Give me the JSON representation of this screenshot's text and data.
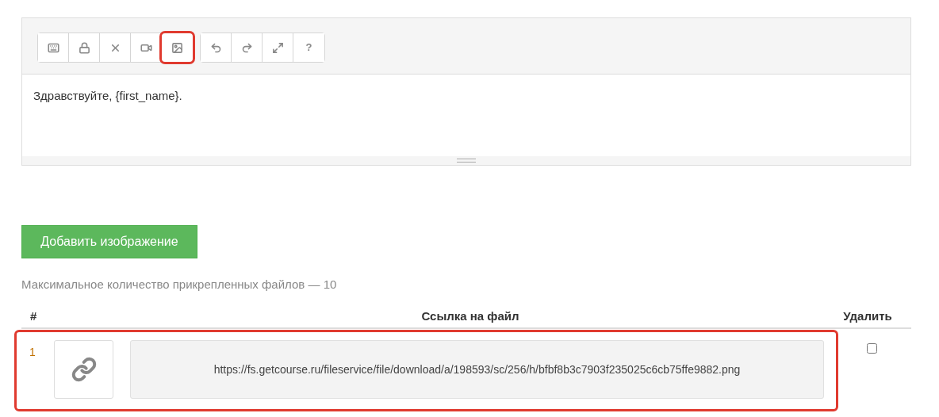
{
  "editor": {
    "toolbar_groups": [
      [
        {
          "kind": "keyboard",
          "highlighted": false
        },
        {
          "kind": "lock",
          "highlighted": false
        },
        {
          "kind": "remove",
          "highlighted": false
        },
        {
          "kind": "video",
          "highlighted": false
        },
        {
          "kind": "image",
          "highlighted": true
        }
      ],
      [
        {
          "kind": "undo",
          "highlighted": false
        },
        {
          "kind": "redo",
          "highlighted": false
        },
        {
          "kind": "fullscreen",
          "highlighted": false
        },
        {
          "kind": "text",
          "label": "?",
          "highlighted": false
        }
      ]
    ],
    "content": "Здравствуйте, {first_name}."
  },
  "add_button": "Добавить изображение",
  "limit_note": "Максимальное количество прикрепленных файлов — 10",
  "table": {
    "columns": [
      "#",
      "Ссылка на файл",
      "Удалить"
    ],
    "rows": [
      {
        "index": "1",
        "url": "https://fs.getcourse.ru/fileservice/file/download/a/198593/sc/256/h/bfbf8b3c7903f235025c6cb75ffe9882.png",
        "checked": false,
        "highlighted": true
      }
    ]
  }
}
